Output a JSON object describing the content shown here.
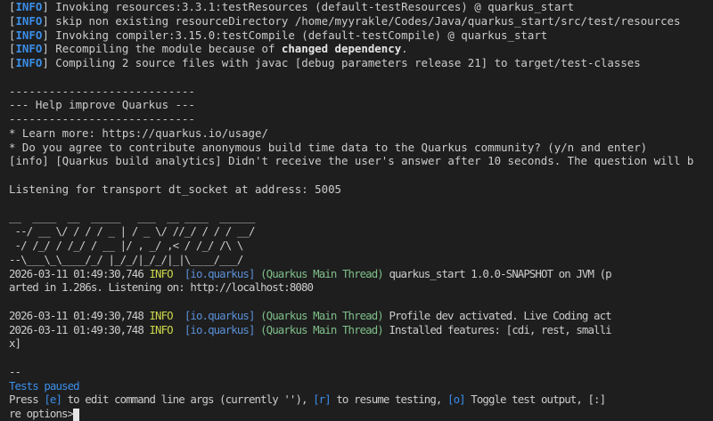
{
  "info_tag": "INFO",
  "maven_lines": [
    "Invoking resources:3.3.1:testResources (default-testResources) @ quarkus_start",
    "skip non existing resourceDirectory /home/myyrakle/Codes/Java/quarkus_start/src/test/resources",
    "Invoking compiler:3.15.0:testCompile (default-testCompile) @ quarkus_start",
    "Compiling 2 source files with javac [debug parameters release 21] to target/test-classes"
  ],
  "recompile": {
    "prefix": "Recompiling the module because of ",
    "bold": "changed dependency",
    "suffix": "."
  },
  "help": {
    "rule": "----------------------------",
    "title": "--- Help improve Quarkus ---",
    "learn": "* Learn more: https://quarkus.io/usage/",
    "question": "* Do you agree to contribute anonymous build time data to the Quarkus community? (y/n and enter)",
    "analytics": "[info] [Quarkus build analytics] Didn't receive the user's answer after 10 seconds. The question will b"
  },
  "listening": "Listening for transport dt_socket at address: 5005",
  "banner": [
    "__  ____  __  _____   ___  __ ____  ______ ",
    " --/ __ \\/ / / / _ | / _ \\/ //_/ / / / __/ ",
    " -/ /_/ / /_/ / __ |/ , _/ ,< / /_/ /\\ \\   ",
    "--\\___\\_\\____/_/ |_/_/|_/_/|_|\\____/___/   "
  ],
  "logs": [
    {
      "ts": "2026-03-11 01:49:30,746",
      "level": "INFO",
      "cat": "[io.quarkus]",
      "thread": "(Quarkus Main Thread)",
      "msg": "quarkus_start 1.0.0-SNAPSHOT on JVM (p"
    },
    {
      "ts": "2026-03-11 01:49:30,748",
      "level": "INFO",
      "cat": "[io.quarkus]",
      "thread": "(Quarkus Main Thread)",
      "msg": "Profile dev activated. Live Coding act"
    },
    {
      "ts": "2026-03-11 01:49:30,748",
      "level": "INFO",
      "cat": "[io.quarkus]",
      "thread": "(Quarkus Main Thread)",
      "msg": "Installed features: [cdi, rest, smalli"
    }
  ],
  "started_wrap": "arted in 1.286s. Listening on: http://localhost:8080",
  "features_wrap": "x]",
  "sep": "--",
  "tests_paused": "Tests paused",
  "press": {
    "a": "Press ",
    "k1": "[e]",
    "b": " to edit command line args (currently ''), ",
    "k2": "[r]",
    "c": " to resume testing, ",
    "k3": "[o]",
    "d": " Toggle test output, ",
    "k4": "[:]"
  },
  "prompt": "re options>"
}
